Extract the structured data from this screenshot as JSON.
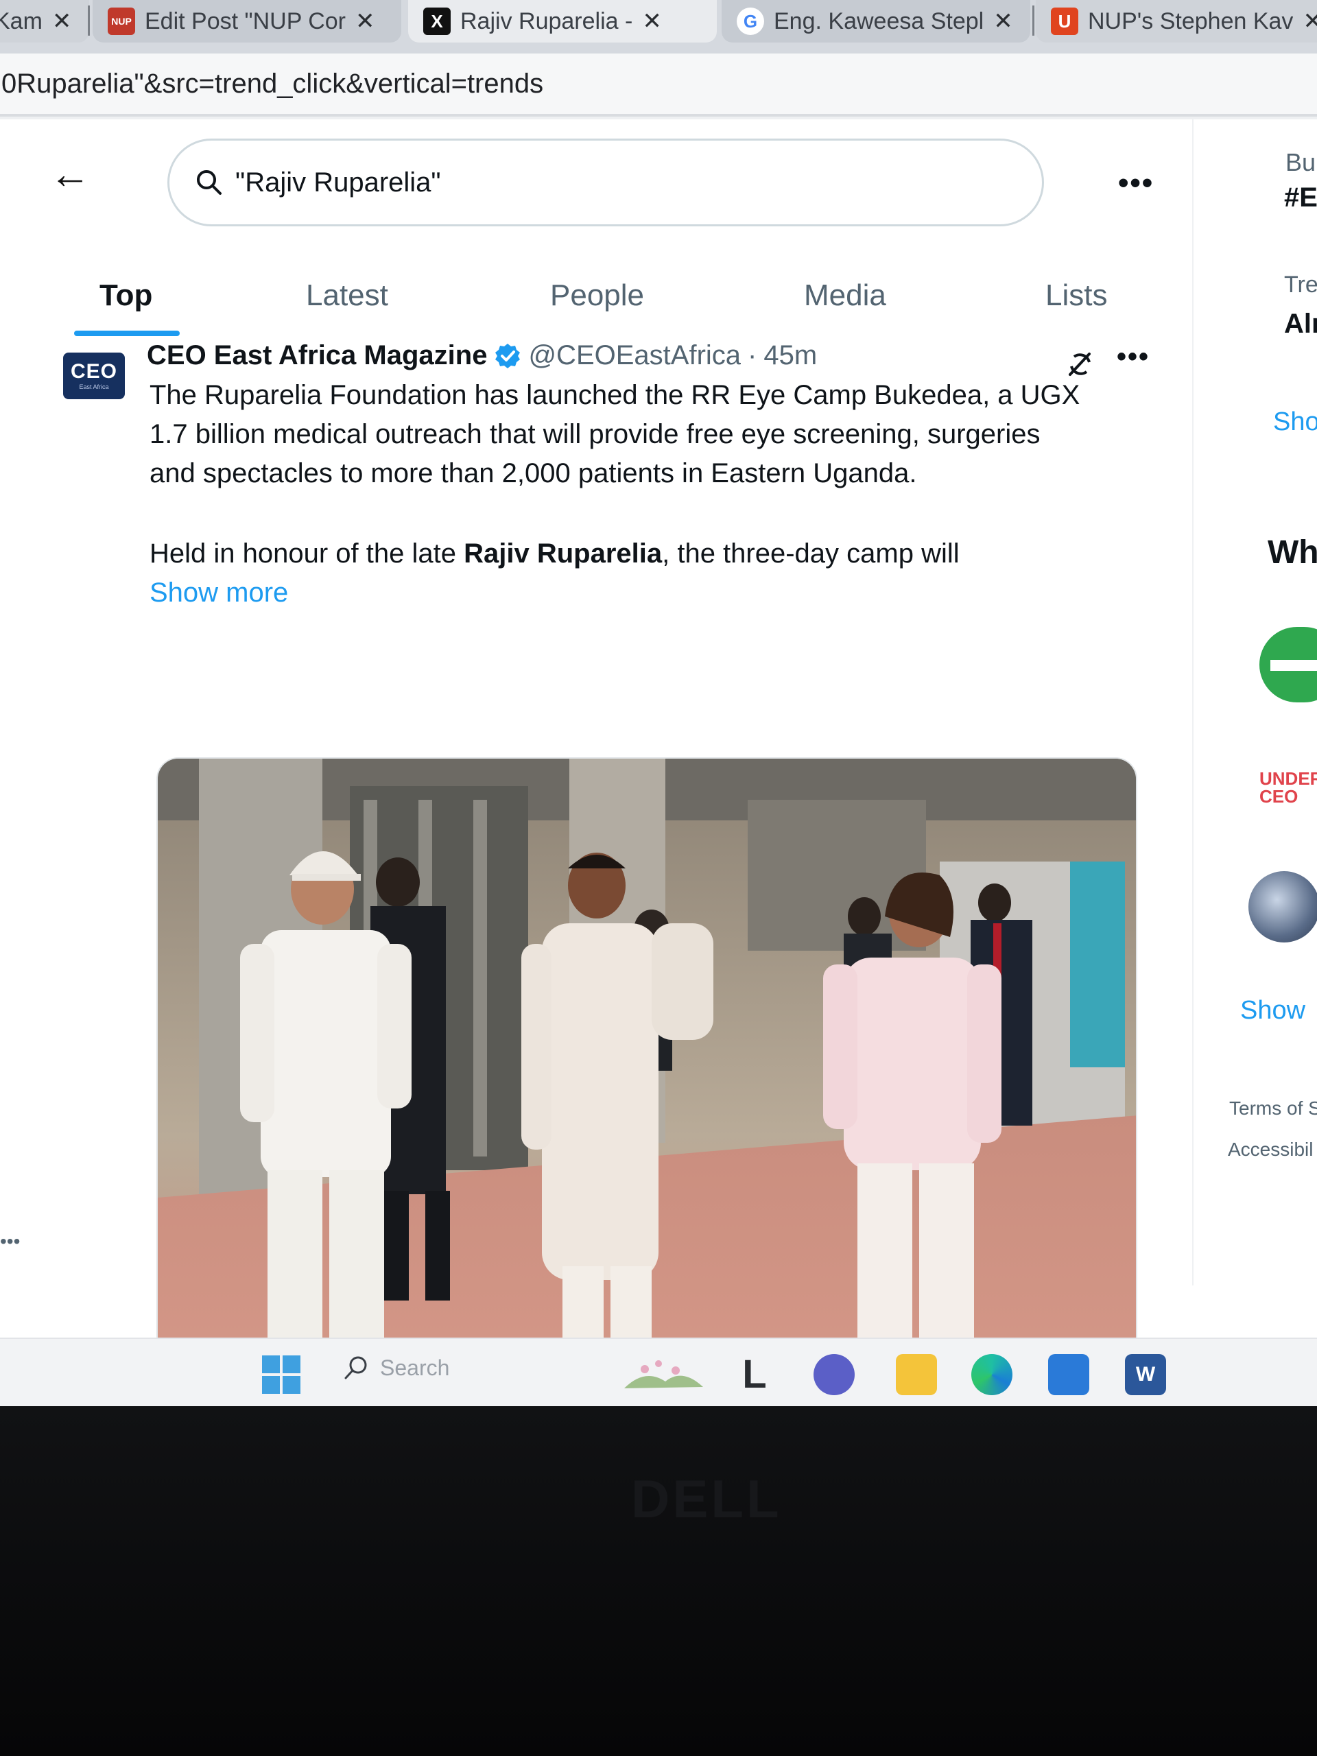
{
  "browser": {
    "tabs": [
      {
        "label": "Kam",
        "favicon": "doc"
      },
      {
        "label": "Edit Post \"NUP Cor",
        "favicon": "nup"
      },
      {
        "label": "Rajiv Ruparelia -",
        "favicon": "x"
      },
      {
        "label": "Eng. Kaweesa Stepl",
        "favicon": "google"
      },
      {
        "label": "NUP's Stephen Kav",
        "favicon": "u"
      }
    ],
    "favicon_letters": {
      "nup": "NUP",
      "google": "G",
      "u": "U",
      "x": "X"
    },
    "close_glyph": "✕",
    "address": "0Ruparelia\"&src=trend_click&vertical=trends"
  },
  "search": {
    "back_glyph": "←",
    "query": "\"Rajiv Ruparelia\"",
    "more_glyph": "•••"
  },
  "search_tabs": [
    "Top",
    "Latest",
    "People",
    "Media",
    "Lists"
  ],
  "tweet": {
    "avatar_text": "CEO",
    "avatar_sub": "East Africa",
    "author_name": "CEO East Africa Magazine",
    "handle": "@CEOEastAfrica",
    "separator": "·",
    "time": "45m",
    "more_glyph": "•••",
    "paragraph1": "The Ruparelia Foundation has launched the RR Eye Camp Bukedea, a UGX\n1.7 billion medical outreach that will provide free eye screening, surgeries\nand spectacles to more than 2,000 patients in Eastern Uganda.",
    "paragraph2_prefix": "Held in honour of the late ",
    "paragraph2_name": "Rajiv Ruparelia",
    "paragraph2_suffix": ", the three-day camp will",
    "show_more": "Show more"
  },
  "sidebar": {
    "bu": "Bu",
    "hash": "#E",
    "tre": "Tre",
    "alr": "Alr",
    "sho": "Sho",
    "wh": "Wh",
    "under": "UNDER",
    "under_sub": "CEO",
    "show": "Show",
    "terms": "Terms of S",
    "access": "Accessibil"
  },
  "left_dots": "•••",
  "taskbar": {
    "search_label": "Search",
    "word_letter": "W",
    "l_glyph": "L"
  },
  "bezel_logo": "DELL",
  "colors": {
    "accent": "#1d9bf0",
    "verified": "#1d9bf0",
    "text_primary": "#0f1419",
    "text_secondary": "#536471"
  }
}
